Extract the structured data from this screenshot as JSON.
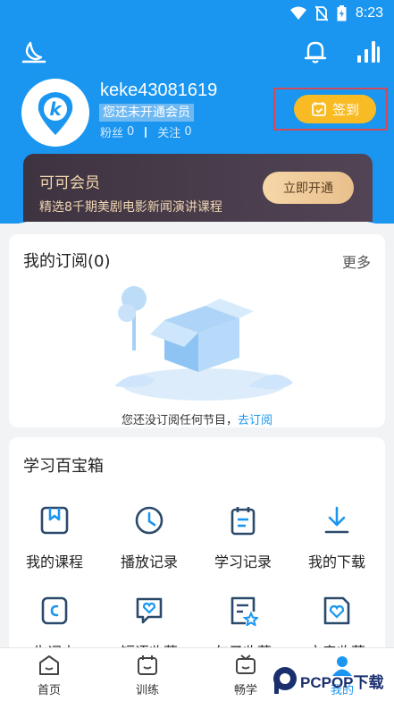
{
  "status_bar": {
    "time": "8:23"
  },
  "header": {
    "username": "keke43081619",
    "member_tip": "您还未开通会员",
    "fans_label": "粉丝",
    "fans_count": "0",
    "follow_label": "关注",
    "follow_count": "0",
    "signin_label": "签到",
    "avatar_letter": "k"
  },
  "vip": {
    "title": "可可会员",
    "subtitle": "精选8千期美剧电影新闻演讲课程",
    "button": "立即开通"
  },
  "subscriptions": {
    "title": "我的订阅(0)",
    "more": "更多",
    "empty_text": "您还没订阅任何节目，",
    "empty_link": "去订阅"
  },
  "toolbox": {
    "title": "学习百宝箱",
    "items": [
      {
        "label": "我的课程",
        "icon": "bookmark-book-icon"
      },
      {
        "label": "播放记录",
        "icon": "clock-icon"
      },
      {
        "label": "学习记录",
        "icon": "notebook-icon"
      },
      {
        "label": "我的下载",
        "icon": "download-icon"
      },
      {
        "label": "生词本",
        "icon": "word-book-icon"
      },
      {
        "label": "短语收藏",
        "icon": "heart-chat-icon"
      },
      {
        "label": "句子收藏",
        "icon": "star-note-icon"
      },
      {
        "label": "文章收藏",
        "icon": "heart-doc-icon"
      }
    ]
  },
  "tabs": [
    {
      "label": "首页",
      "icon": "home-icon"
    },
    {
      "label": "训练",
      "icon": "train-icon"
    },
    {
      "label": "畅学",
      "icon": "tv-icon"
    },
    {
      "label": "我的",
      "icon": "profile-icon",
      "active": true
    }
  ],
  "watermark": {
    "text": "PCPOP下载"
  },
  "colors": {
    "primary": "#1a96f0",
    "signin": "#f8bb23",
    "vip_bg": "#3e3340"
  }
}
